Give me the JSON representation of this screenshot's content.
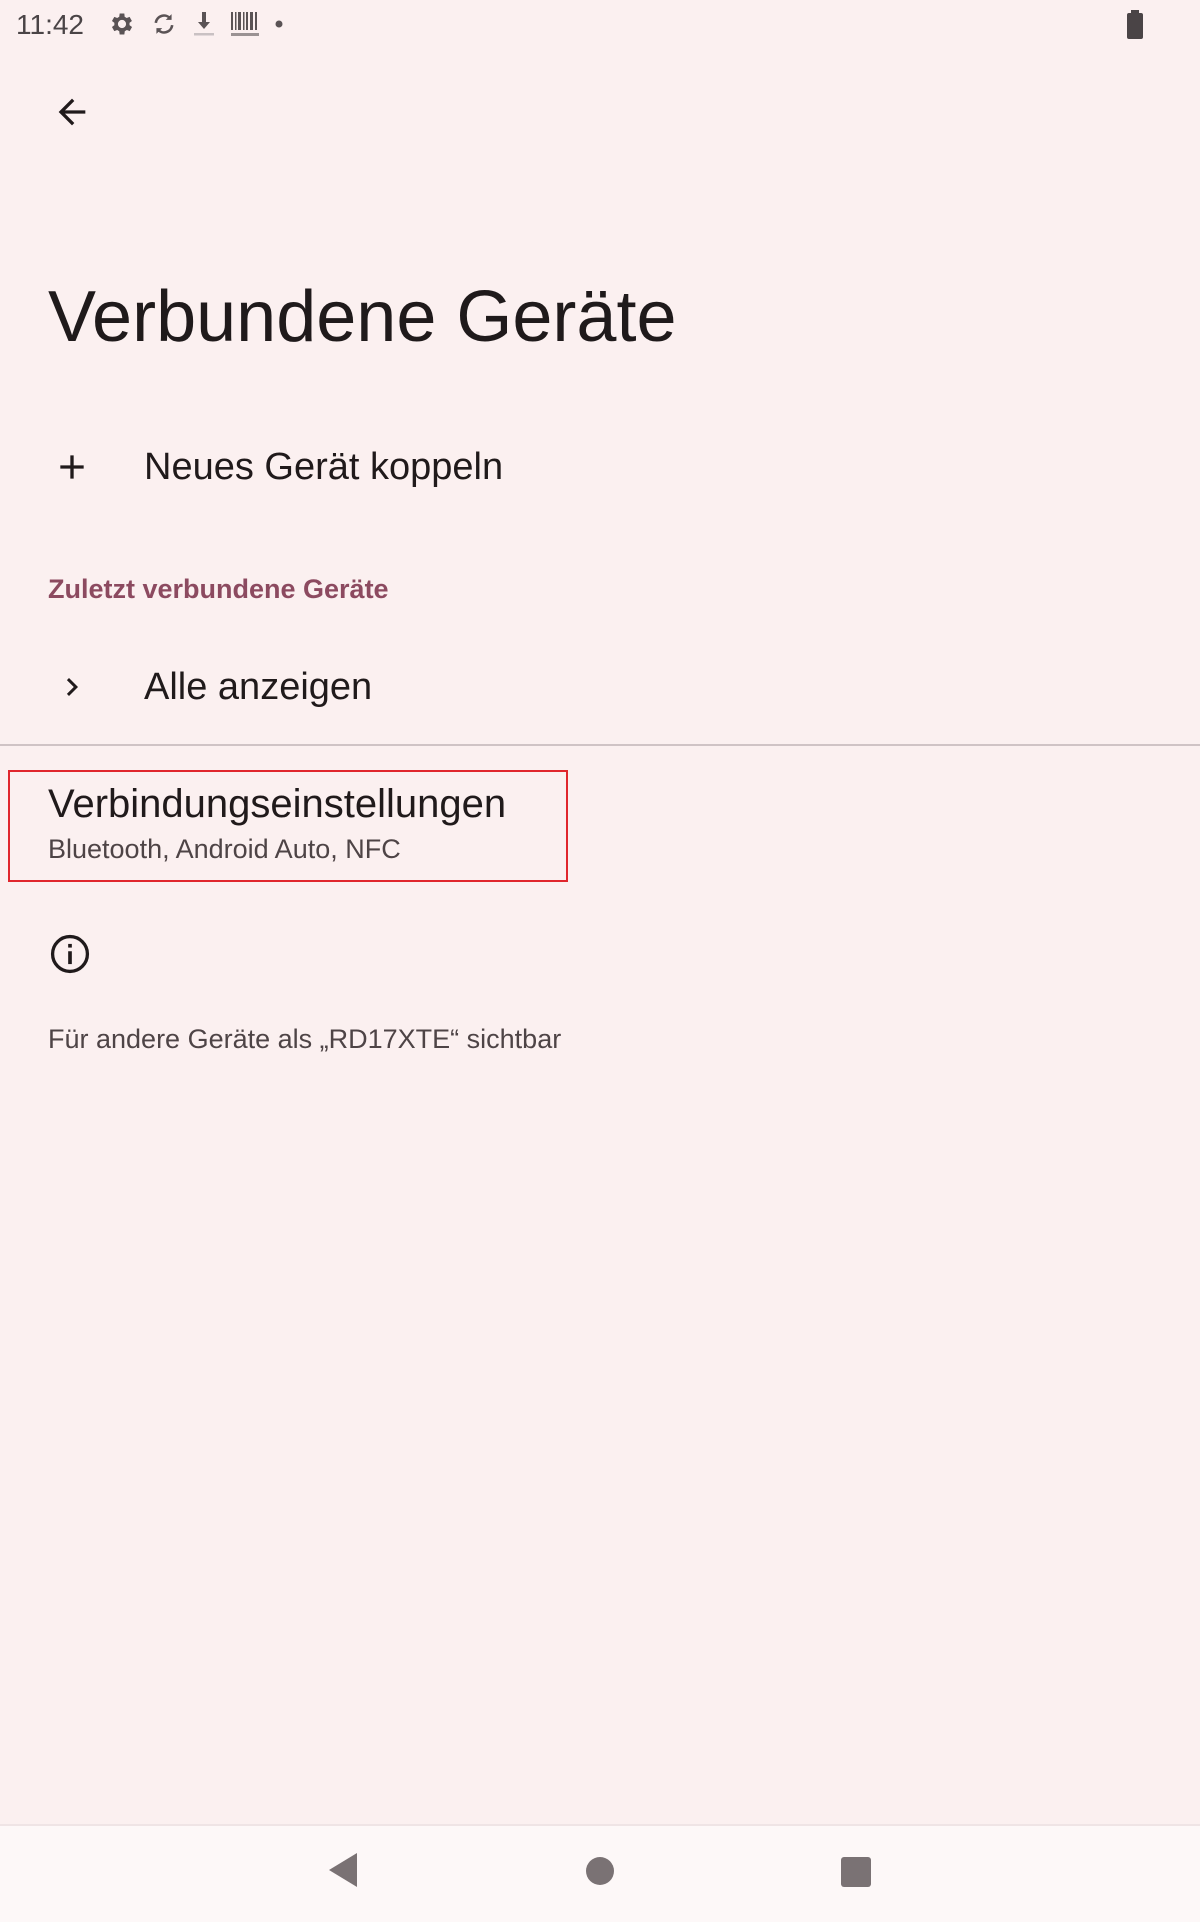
{
  "status_bar": {
    "time": "11:42",
    "icons": [
      "settings-icon",
      "sync-icon",
      "download-icon",
      "barcode-icon",
      "dot-icon"
    ],
    "battery_icon": "battery-icon"
  },
  "header": {
    "back_icon": "arrow-back-icon",
    "title": "Verbundene Geräte"
  },
  "pair_new": {
    "icon": "plus-icon",
    "label": "Neues Gerät koppeln"
  },
  "recent_section": {
    "label": "Zuletzt verbundene Geräte",
    "see_all_icon": "chevron-right-icon",
    "see_all_label": "Alle anzeigen"
  },
  "connection_settings": {
    "title": "Verbindungseinstellungen",
    "subtitle": "Bluetooth, Android Auto, NFC"
  },
  "footer": {
    "info_icon": "info-icon",
    "text": "Für andere Geräte als „RD17XTE“ sichtbar"
  },
  "nav_bar": {
    "buttons": [
      "nav-back-icon",
      "nav-home-icon",
      "nav-recents-icon"
    ]
  },
  "colors": {
    "background": "#fbf0f0",
    "accent": "#8c4a60",
    "highlight_box": "#e0262d"
  }
}
